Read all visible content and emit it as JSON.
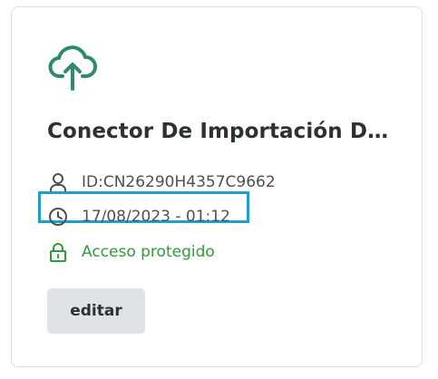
{
  "card": {
    "icon": "cloud-upload-icon",
    "title": "Conector De Importación De Datos",
    "id_icon": "user-icon",
    "id_text": "ID:CN26290H4357C9662",
    "date_icon": "clock-icon",
    "date_text": "17/08/2023 - 01:12",
    "access_icon": "lock-icon",
    "access_text": "Acceso protegido",
    "edit_label": "editar"
  },
  "colors": {
    "accent_green": "#2f9a3e",
    "icon_teal": "#2e8a6e",
    "highlight": "#1ea0c8",
    "button_bg": "#dfe3e5"
  }
}
